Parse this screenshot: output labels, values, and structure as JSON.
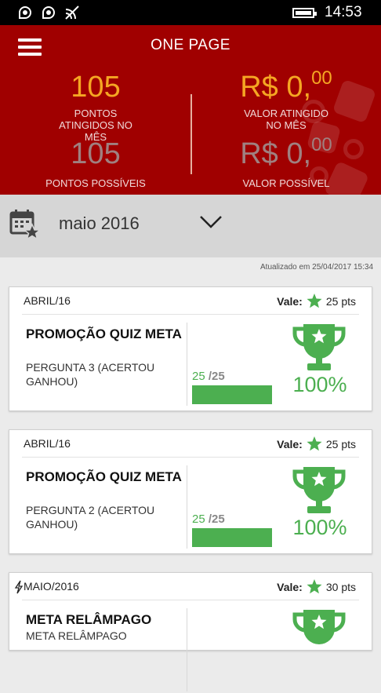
{
  "status_bar": {
    "time": "14:53"
  },
  "header": {
    "title": "ONE PAGE",
    "points_achieved": "105",
    "points_achieved_label": "PONTOS ATINGIDOS NO MÊS",
    "points_possible": "105",
    "points_possible_label": "PONTOS POSSÍVEIS",
    "value_achieved": "R$ 0,",
    "value_achieved_cents": "00",
    "value_achieved_label": "VALOR ATINGIDO NO MÊS",
    "value_possible": "R$ 0,",
    "value_possible_cents": "00",
    "value_possible_label": "VALOR POSSÍVEL",
    "accent_color": "#a00000",
    "highlight_color": "#f5a623"
  },
  "month_selector": {
    "value": "maio 2016"
  },
  "updated_text": "Atualizado em 25/04/2017 15:34",
  "cards": [
    {
      "date": "ABRIL/16",
      "vale_label": "Vale:",
      "points": "25 pts",
      "title": "PROMOÇÃO QUIZ META",
      "subtitle": "PERGUNTA 3 (ACERTOU GANHOU)",
      "score_got": "25",
      "score_total": "/25",
      "progress_fraction": 1.0,
      "percent": "100%"
    },
    {
      "date": "ABRIL/16",
      "vale_label": "Vale:",
      "points": "25 pts",
      "title": "PROMOÇÃO QUIZ META",
      "subtitle": "PERGUNTA 2 (ACERTOU GANHOU)",
      "score_got": "25",
      "score_total": "/25",
      "progress_fraction": 1.0,
      "percent": "100%"
    },
    {
      "date": "MAIO/2016",
      "vale_label": "Vale:",
      "points": "30 pts",
      "title": "META RELÂMPAGO",
      "subtitle": "META RELÂMPAGO"
    }
  ],
  "colors": {
    "green": "#4caf50"
  },
  "icons": [
    "menu-icon",
    "calendar-star-icon",
    "chevron-down-icon",
    "star-icon",
    "trophy-icon",
    "lightning-icon",
    "battery-icon",
    "wifi-icon"
  ]
}
